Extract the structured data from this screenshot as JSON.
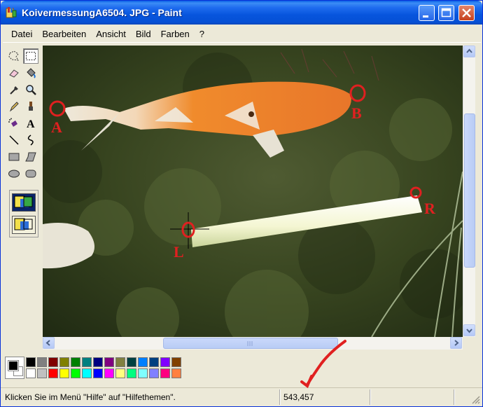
{
  "window": {
    "title": "KoivermessungA6504. JPG - Paint"
  },
  "menu": [
    "Datei",
    "Bearbeiten",
    "Ansicht",
    "Bild",
    "Farben",
    "?"
  ],
  "canvas": {
    "marker_labels": {
      "a": "A",
      "b": "B",
      "l": "L",
      "r": "R"
    }
  },
  "palette": {
    "current": {
      "foreground": "#000000",
      "background": "#FFFFFF"
    },
    "colors_top": [
      "#000000",
      "#808080",
      "#800000",
      "#808000",
      "#008000",
      "#008080",
      "#000080",
      "#800080",
      "#808040",
      "#004040",
      "#0080FF",
      "#004080",
      "#8000FF",
      "#804000"
    ],
    "colors_bottom": [
      "#FFFFFF",
      "#C0C0C0",
      "#FF0000",
      "#FFFF00",
      "#00FF00",
      "#00FFFF",
      "#0000FF",
      "#FF00FF",
      "#FFFF80",
      "#00FF80",
      "#80FFFF",
      "#8080FF",
      "#FF0080",
      "#FF8040"
    ]
  },
  "status": {
    "help_text": "Klicken Sie im Menü \"Hilfe\" auf \"Hilfethemen\".",
    "coords": "543,457"
  },
  "colors": {
    "title_bar": "#0A5FE6",
    "annotation_red": "#E02020"
  }
}
